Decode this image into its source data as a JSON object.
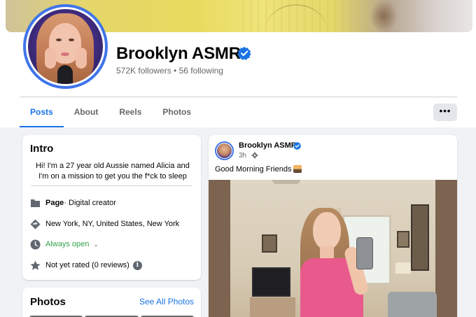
{
  "profile": {
    "name": "Brooklyn ASMR",
    "stats": "572K followers • 56 following",
    "verified": true,
    "accent_color": "#1b74e4"
  },
  "tabs": [
    {
      "label": "Posts",
      "active": true
    },
    {
      "label": "About",
      "active": false
    },
    {
      "label": "Reels",
      "active": false
    },
    {
      "label": "Photos",
      "active": false
    }
  ],
  "more_button_label": "•••",
  "intro": {
    "title": "Intro",
    "bio": "Hi! I'm a 27 year old Aussie named Alicia and I'm on a mission to get you the f*ck to sleep",
    "page_label": "Page",
    "page_category": " · Digital creator",
    "location": "New York, NY, United States, New York",
    "hours": "Always open",
    "rating": "Not yet rated (0 reviews)",
    "icons": [
      "page-icon",
      "location-icon",
      "clock-icon",
      "star-icon",
      "info-icon"
    ]
  },
  "photos": {
    "title": "Photos",
    "see_all_label": "See All Photos"
  },
  "post": {
    "author": "Brooklyn ASMR",
    "time": "3h",
    "text": "Good Morning Friends",
    "emoji_icon": "sunrise-icon"
  }
}
